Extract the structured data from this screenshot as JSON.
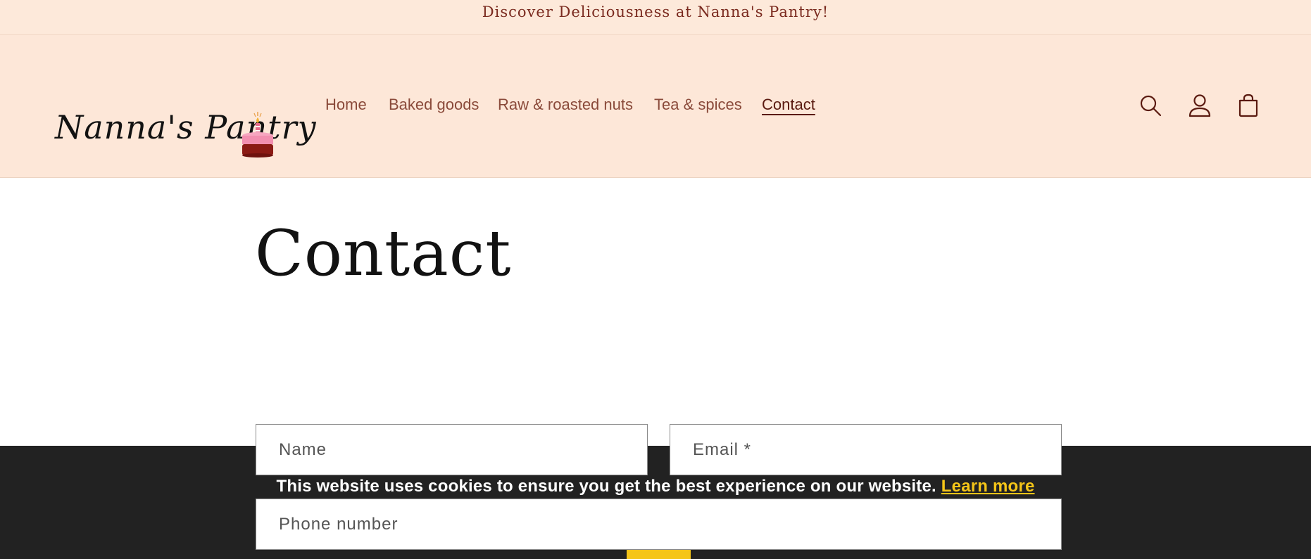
{
  "announcement": {
    "text": "Discover Deliciousness at Nanna's Pantry!"
  },
  "header": {
    "logo_text": "Nanna's Pantry",
    "nav": [
      {
        "label": "Home",
        "active": false
      },
      {
        "label": "Baked goods",
        "active": false
      },
      {
        "label": "Raw & roasted nuts",
        "active": false
      },
      {
        "label": "Tea & spices",
        "active": false
      },
      {
        "label": "Contact",
        "active": true
      }
    ],
    "icons": [
      "search-icon",
      "account-icon",
      "cart-icon"
    ]
  },
  "main": {
    "title": "Contact",
    "form": {
      "name_placeholder": "Name",
      "email_placeholder": "Email *",
      "phone_placeholder": "Phone number"
    }
  },
  "cookie_banner": {
    "message": "This website uses cookies to ensure you get the best experience on our website.",
    "link_label": "Learn more",
    "accent_color": "#f5c518"
  },
  "colors": {
    "announcement_bg": "#fde9da",
    "header_bg": "#fde7d8",
    "nav_text": "#8a4a3a",
    "cookie_bg": "#222222"
  }
}
